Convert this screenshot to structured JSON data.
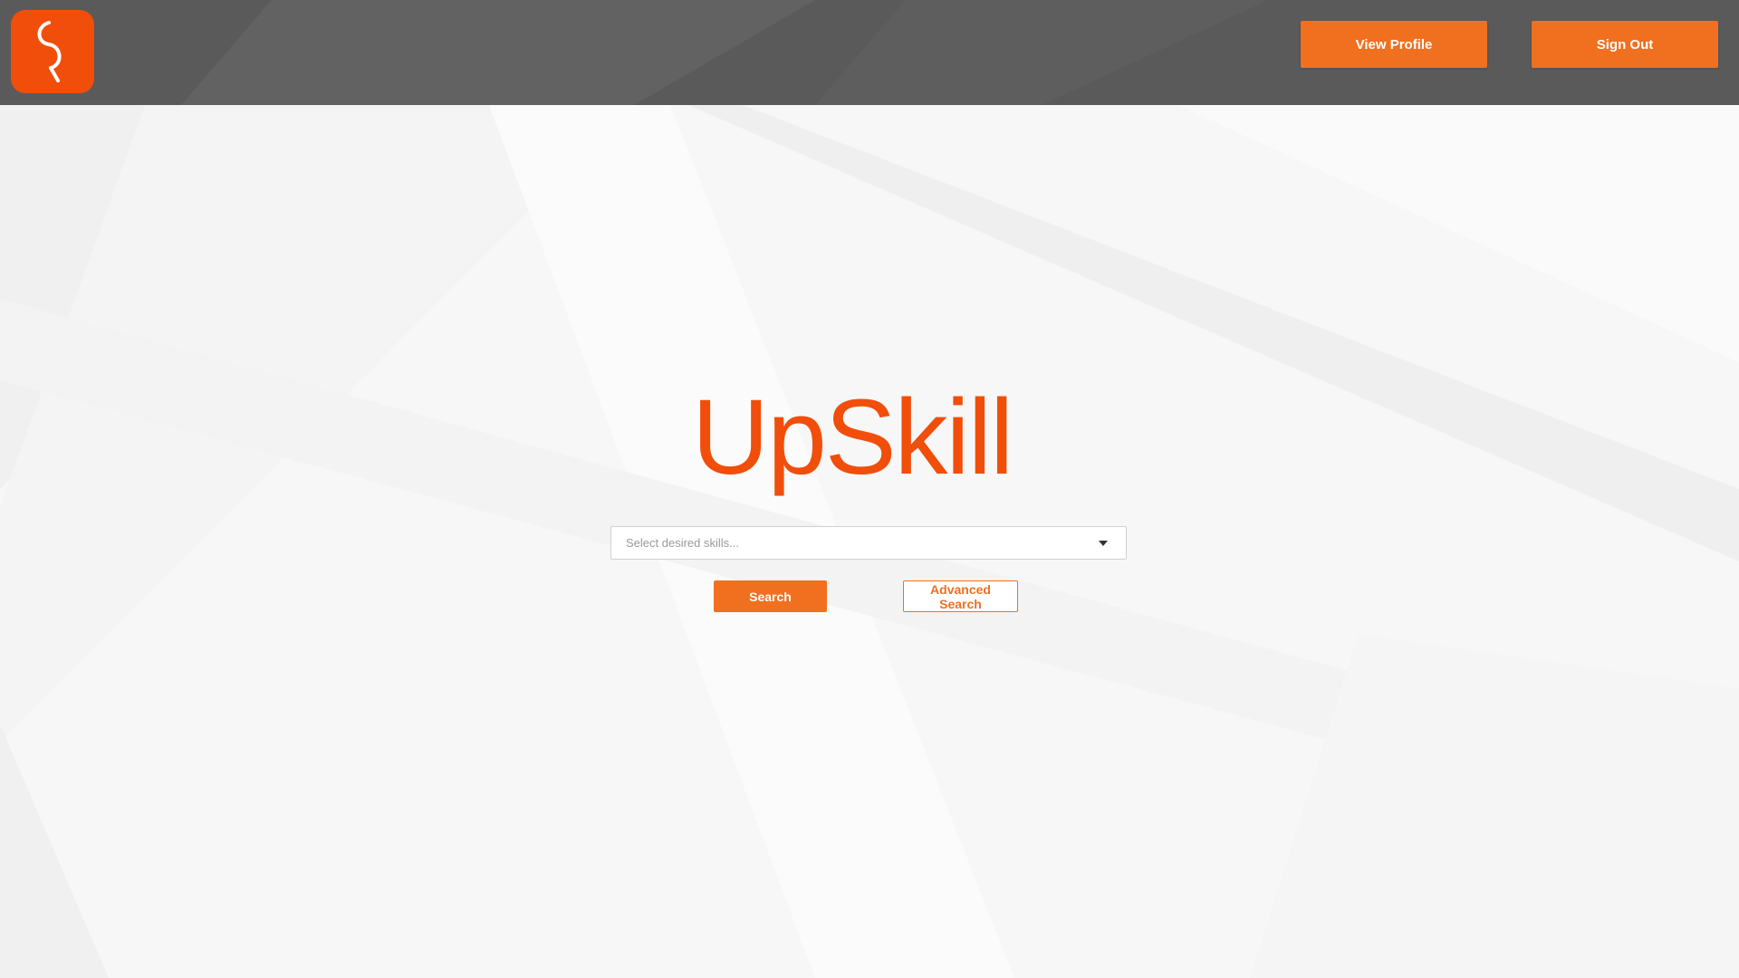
{
  "header": {
    "logo_icon": "upskill-app-icon",
    "view_profile_label": "View Profile",
    "sign_out_label": "Sign Out"
  },
  "main": {
    "brand_name": "UpSkill",
    "skills_select": {
      "placeholder": "Select desired skills...",
      "icon": "chevron-down-icon"
    },
    "search_label": "Search",
    "advanced_search_label": "Advanced Search"
  },
  "colors": {
    "accent": "#f07020",
    "brand": "#f04e0a",
    "header_bg": "#5a5a5a",
    "page_bg": "#f7f7f7"
  }
}
